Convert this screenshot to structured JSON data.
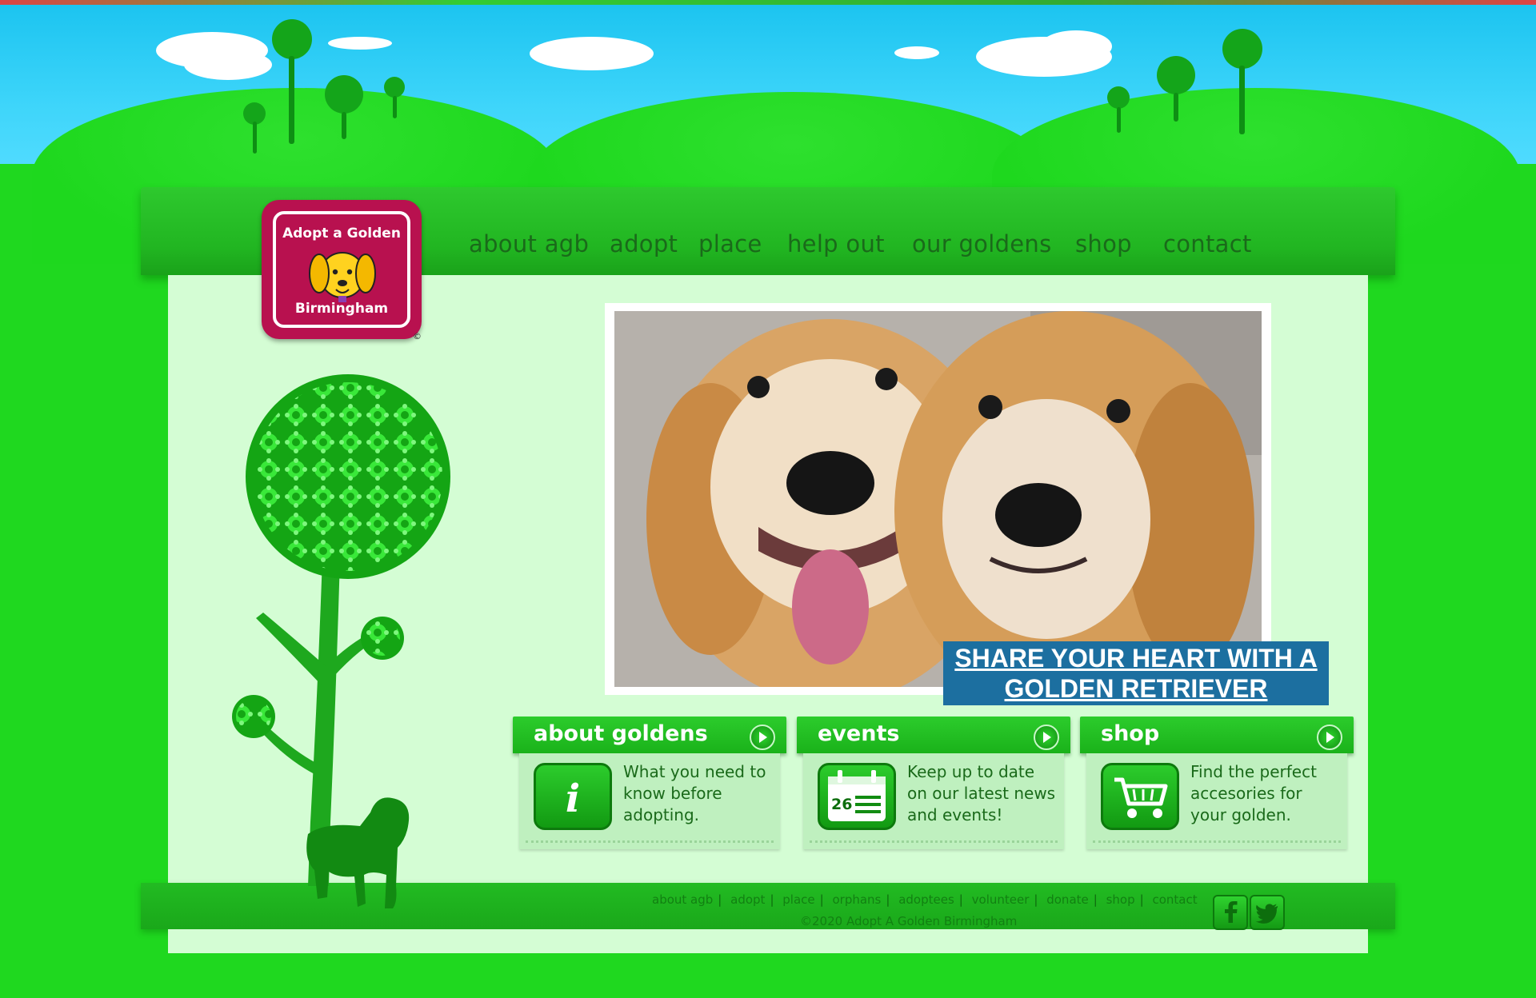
{
  "logo": {
    "line1": "Adopt a Golden",
    "line2": "Birmingham",
    "copyright": "©"
  },
  "nav": [
    {
      "label": "about agb"
    },
    {
      "label": "adopt"
    },
    {
      "label": "place"
    },
    {
      "label": "help out"
    },
    {
      "label": "our goldens"
    },
    {
      "label": "shop"
    },
    {
      "label": "contact"
    }
  ],
  "hero": {
    "banner_line1": "SHARE YOUR HEART WITH A",
    "banner_line2": "GOLDEN RETRIEVER"
  },
  "cards": [
    {
      "title": "about goldens",
      "text": "What you need to know before adopting.",
      "icon": "info-icon"
    },
    {
      "title": "events",
      "text": "Keep up to date on our latest news and events!",
      "icon": "calendar-icon",
      "calendar_day": "26"
    },
    {
      "title": "shop",
      "text": "Find the perfect accesories for your golden.",
      "icon": "cart-icon"
    }
  ],
  "footer": {
    "links": [
      "about agb",
      "adopt",
      "place",
      "orphans",
      "adoptees",
      "volunteer",
      "donate",
      "shop",
      "contact"
    ],
    "copyright": "©2020 Adopt A Golden Birmingham",
    "social": [
      "facebook-icon",
      "twitter-icon"
    ]
  },
  "colors": {
    "background": "#1fd81f",
    "content": "#d4fdd4",
    "banner": "#1c6fa0",
    "logo": "#b8114f",
    "nav_text": "#1a6a1a"
  }
}
